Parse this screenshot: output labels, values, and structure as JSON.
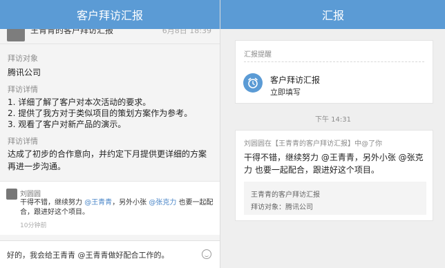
{
  "left": {
    "header_title": "客户拜访汇报",
    "peek_title": "王青青的客户拜访汇报",
    "peek_date": "6月8日 18:39",
    "visit_target_label": "拜访对象",
    "visit_target_value": "腾讯公司",
    "visit_detail_label": "拜访详情",
    "visit_detail_items": [
      "1. 详细了解了客户对本次活动的要求。",
      "2. 提供了我方对于类似项目的策划方案作为参考。",
      "3. 观看了客户对新产品的演示。"
    ],
    "conclusion_label": "拜访详情",
    "conclusion_text": "达成了初步的合作意向，并约定下月提供更详细的方案再进一步沟通。",
    "comment": {
      "author": "刘圆圆",
      "text_before": "干得不错，继续努力 ",
      "mention1": "@王青青",
      "text_middle": "，另外小张 ",
      "mention2": "@张克力",
      "text_after": " 也要一起配合，跟进好这个项目。",
      "time": "10分钟前"
    },
    "input_value": "好的，我会给王青青 @王青青做好配合工作的。"
  },
  "right": {
    "header_title": "汇报",
    "reminder_label": "汇报提醒",
    "reminder_title": "客户拜访汇报",
    "reminder_action": "立即填写",
    "time_label": "下午 14:31",
    "mention_header": "刘圆圆在【王青青的客户拜访汇报】中@了你",
    "message": "干得不错，继续努力 @王青青，另外小张 @张克力 也要一起配合，跟进好这个项目。",
    "ref_title": "王青青的客户拜访汇报",
    "ref_sub": "拜访对象：腾讯公司"
  },
  "colors": {
    "accent": "#5b9bd5",
    "mention": "#4a86c8"
  },
  "icons": {
    "clock": "alarm-clock-icon",
    "emoji": "smiley-icon"
  }
}
